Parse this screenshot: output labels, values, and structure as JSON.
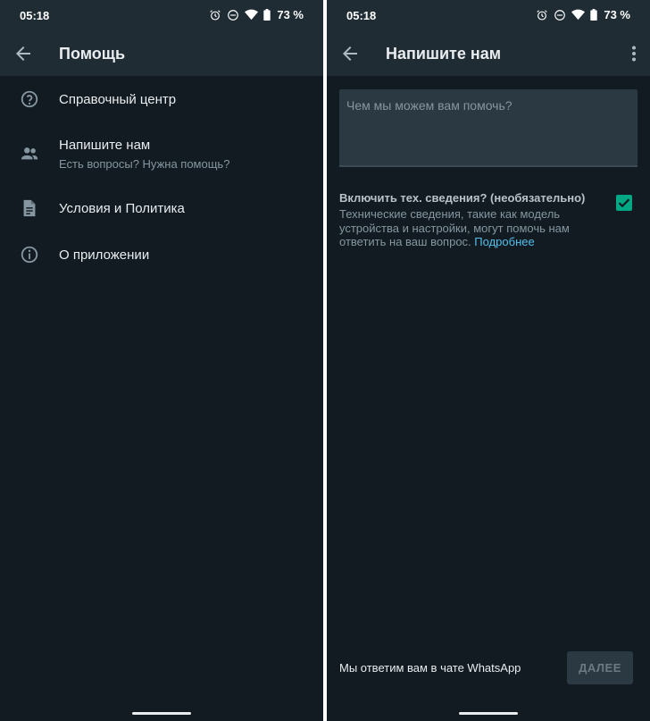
{
  "left_screen": {
    "status": {
      "time": "05:18",
      "battery": "73 %"
    },
    "appbar": {
      "title": "Помощь"
    },
    "menu": [
      {
        "label": "Справочный центр",
        "icon": "help-circle-icon"
      },
      {
        "label": "Напишите нам",
        "sub": "Есть вопросы? Нужна помощь?",
        "icon": "group-icon"
      },
      {
        "label": "Условия и Политика",
        "icon": "document-icon"
      },
      {
        "label": "О приложении",
        "icon": "info-icon"
      }
    ]
  },
  "right_screen": {
    "status": {
      "time": "05:18",
      "battery": "73 %"
    },
    "appbar": {
      "title": "Напишите нам"
    },
    "message": {
      "placeholder": "Чем мы можем вам помочь?"
    },
    "tech_info": {
      "title": "Включить тех. сведения? (необязательно)",
      "description": "Технические сведения, такие как модель устройства и настройки, могут помочь нам ответить на ваш вопрос.",
      "link": "Подробнее",
      "checked": true
    },
    "footer": {
      "text": "Мы ответим вам в чате WhatsApp",
      "next_button": "ДАЛЕЕ"
    }
  },
  "colors": {
    "background": "#121b22",
    "bar": "#1f2c34",
    "accent": "#00a884",
    "link": "#53bdeb"
  }
}
